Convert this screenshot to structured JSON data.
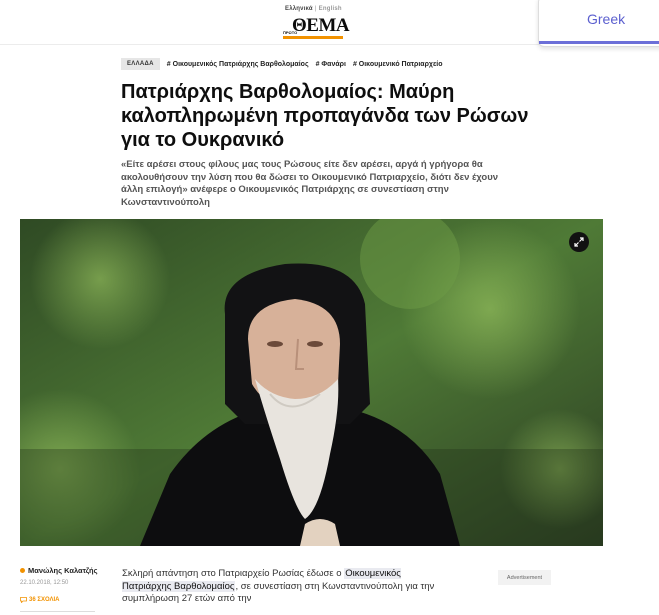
{
  "header": {
    "lang_greek": "Ελληνικά",
    "lang_sep": "|",
    "lang_english": "English",
    "logo_prefix": "ΠΡΩΤΟ",
    "logo_text": "ΘΕΜΑ",
    "logo_accent": "#f29200"
  },
  "translate_widget": {
    "label": "Greek",
    "color": "#5b5fcf"
  },
  "article": {
    "category": "ΕΛΛΑΔΑ",
    "tags": [
      "# Οικουμενικός Πατριάρχης Βαρθολομαίος",
      "# Φανάρι",
      "# Οικουμενικό Πατριαρχείο"
    ],
    "title": "Πατριάρχης Βαρθολομαίος: Μαύρη καλοπληρωμένη προπαγάνδα των Ρώσων για το Ουκρανικό",
    "lead": "«Είτε αρέσει στους φίλους μας τους Ρώσους είτε δεν αρέσει, αργά ή γρήγορα θα ακολουθήσουν την λύση που θα δώσει το Οικουμενικό Πατριαρχείο, διότι δεν έχουν άλλη επιλογή» ανέφερε ο Οικουμενικός Πατριάρχης σε συνεστίαση στην Κωνσταντινούπολη",
    "image_icon": "expand-icon",
    "author": "Μανώλης Καλατζής",
    "date": "22.10.2018, 12:50",
    "comments": "36 ΣΧΟΛΙΑ",
    "body_pre": "Σκληρή απάντηση στο Πατριαρχείο Ρωσίας έδωσε ο",
    "body_link": "Οικουμενικός Πατριάρχης Βαρθολομαίος",
    "body_post": ", σε συνεστίαση στη Κωνσταντινούπολη για την συμπλήρωση 27 ετών από την",
    "advertisement": "Advertisement"
  }
}
